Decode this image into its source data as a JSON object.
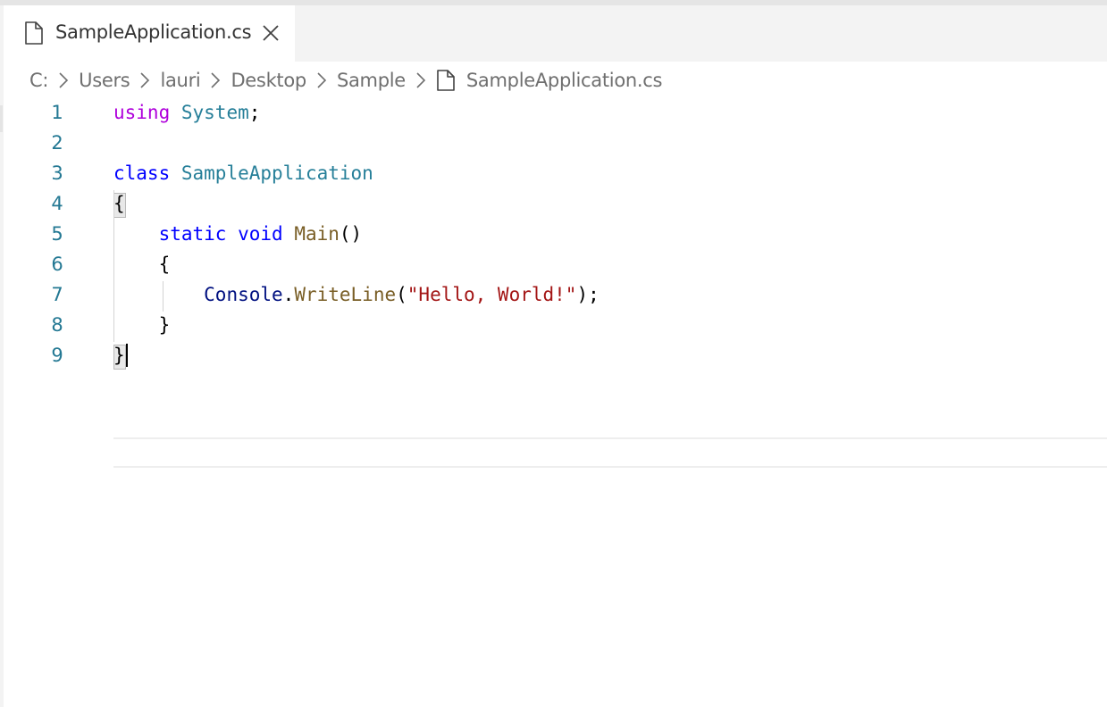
{
  "tab": {
    "label": "SampleApplication.cs",
    "file_icon": "file-icon",
    "close_icon": "close-icon"
  },
  "breadcrumb": {
    "items": [
      "C:",
      "Users",
      "lauri",
      "Desktop",
      "Sample"
    ],
    "file": "SampleApplication.cs",
    "separator_icon": "chevron-right-icon",
    "file_icon": "file-icon"
  },
  "editor": {
    "language": "csharp",
    "lines": [
      {
        "number": "1",
        "tokens": [
          {
            "t": "using",
            "c": "kw-purple"
          },
          {
            "t": " ",
            "c": "plain"
          },
          {
            "t": "System",
            "c": "type"
          },
          {
            "t": ";",
            "c": "plain"
          }
        ]
      },
      {
        "number": "2",
        "tokens": []
      },
      {
        "number": "3",
        "tokens": [
          {
            "t": "class",
            "c": "kw-blue"
          },
          {
            "t": " ",
            "c": "plain"
          },
          {
            "t": "SampleApplication",
            "c": "type"
          }
        ]
      },
      {
        "number": "4",
        "tokens": [
          {
            "t": "{",
            "c": "plain"
          }
        ]
      },
      {
        "number": "5",
        "tokens": [
          {
            "t": "    ",
            "c": "plain"
          },
          {
            "t": "static",
            "c": "kw-blue"
          },
          {
            "t": " ",
            "c": "plain"
          },
          {
            "t": "void",
            "c": "kw-blue"
          },
          {
            "t": " ",
            "c": "plain"
          },
          {
            "t": "Main",
            "c": "func"
          },
          {
            "t": "()",
            "c": "plain"
          }
        ]
      },
      {
        "number": "6",
        "tokens": [
          {
            "t": "    {",
            "c": "plain"
          }
        ]
      },
      {
        "number": "7",
        "tokens": [
          {
            "t": "        ",
            "c": "plain"
          },
          {
            "t": "Console",
            "c": "var"
          },
          {
            "t": ".",
            "c": "plain"
          },
          {
            "t": "WriteLine",
            "c": "func"
          },
          {
            "t": "(",
            "c": "plain"
          },
          {
            "t": "\"Hello, World!\"",
            "c": "str"
          },
          {
            "t": ");",
            "c": "plain"
          }
        ]
      },
      {
        "number": "8",
        "tokens": [
          {
            "t": "    }",
            "c": "plain"
          }
        ]
      },
      {
        "number": "9",
        "tokens": [
          {
            "t": "}",
            "c": "plain"
          }
        ]
      }
    ]
  },
  "colors": {
    "line_number": "#237893",
    "keyword_purple": "#af00db",
    "keyword_blue": "#0000ff",
    "type": "#267f99",
    "function": "#795e26",
    "variable": "#001080",
    "string": "#a31515"
  }
}
